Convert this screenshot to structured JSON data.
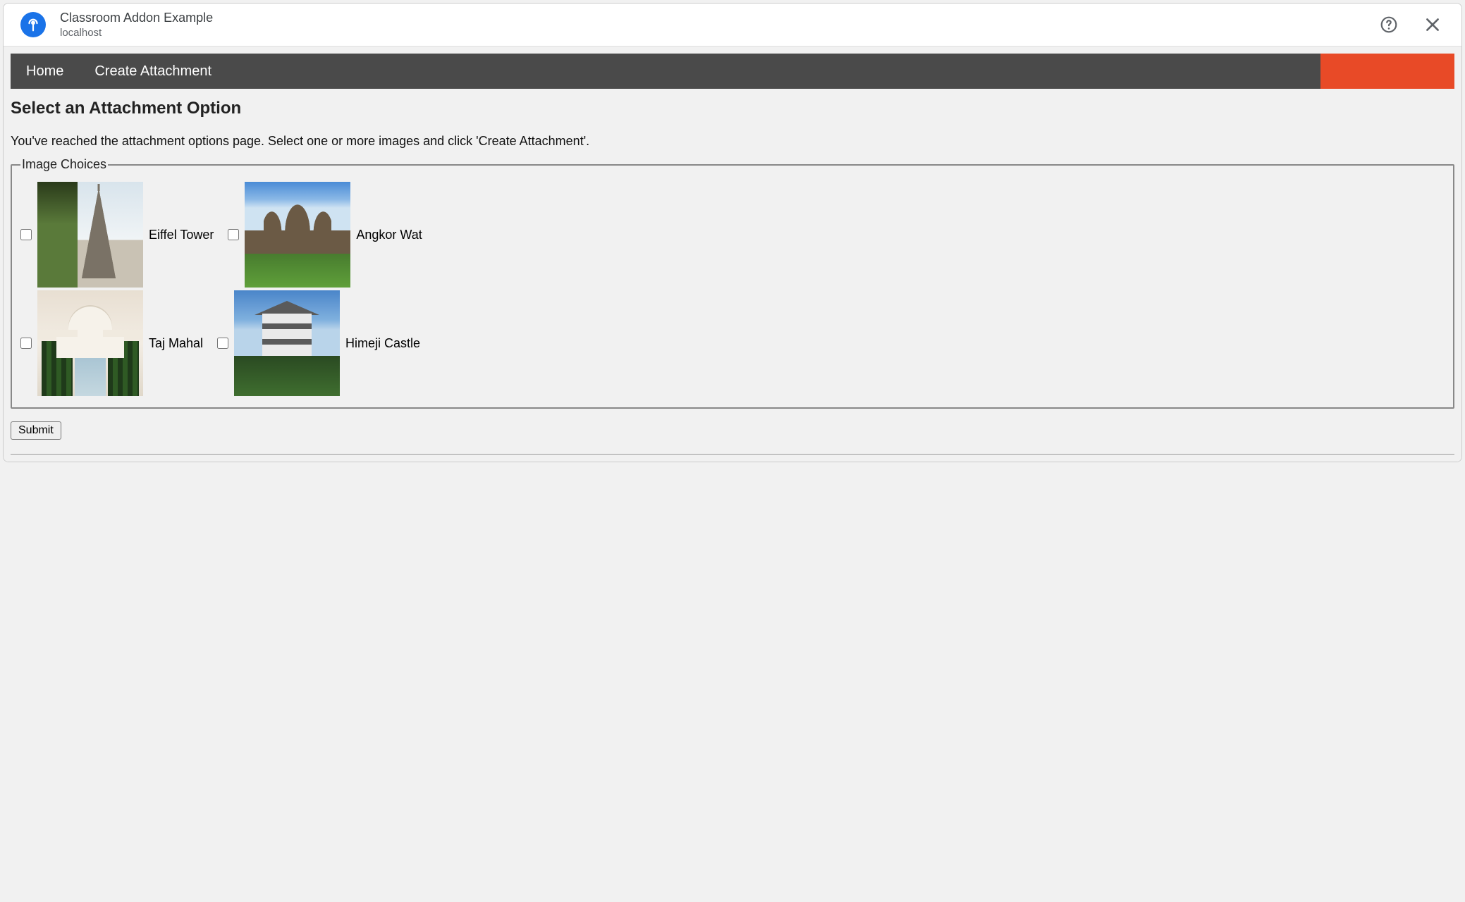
{
  "dialog": {
    "title": "Classroom Addon Example",
    "subtitle": "localhost"
  },
  "nav": {
    "items": [
      {
        "label": "Home"
      },
      {
        "label": "Create Attachment"
      }
    ]
  },
  "page": {
    "heading": "Select an Attachment Option",
    "description": "You've reached the attachment options page. Select one or more images and click 'Create Attachment'.",
    "fieldset_legend": "Image Choices",
    "submit_label": "Submit"
  },
  "choices": [
    {
      "label": "Eiffel Tower"
    },
    {
      "label": "Angkor Wat"
    },
    {
      "label": "Taj Mahal"
    },
    {
      "label": "Himeji Castle"
    }
  ]
}
